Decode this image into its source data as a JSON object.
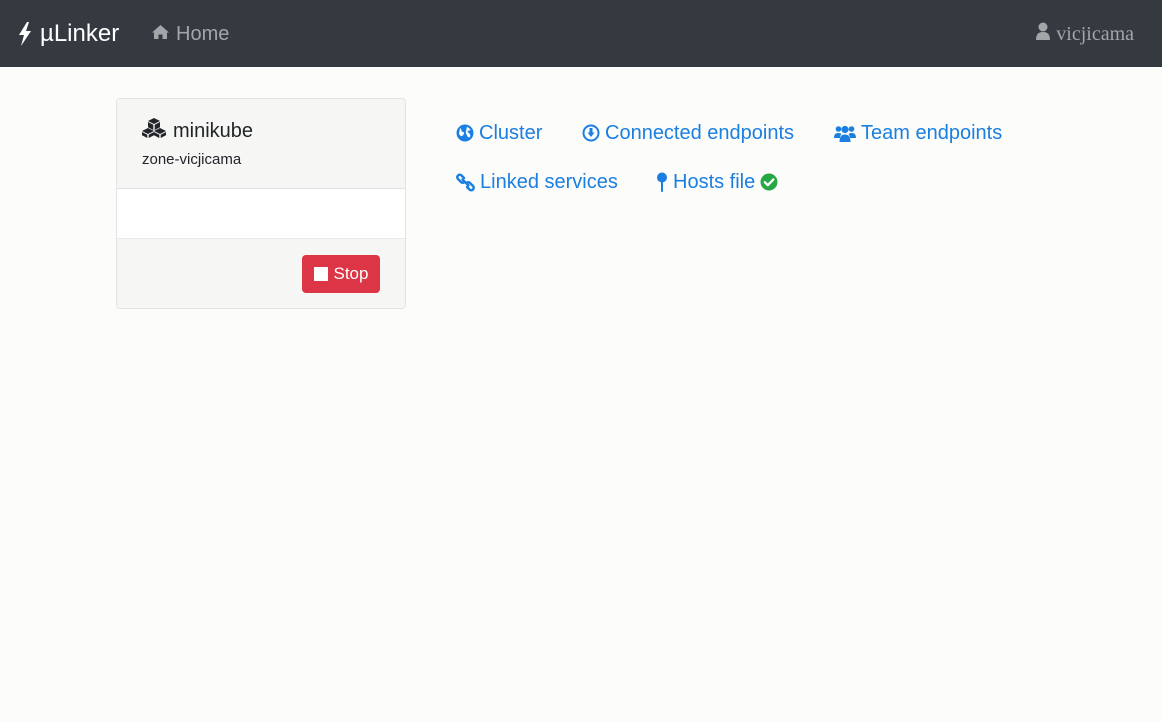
{
  "navbar": {
    "brand_icon": "bolt-icon",
    "brand": "µLinker",
    "home_icon": "home-icon",
    "home": "Home",
    "user_icon": "user-icon",
    "user": "vicjicama"
  },
  "card": {
    "icon": "cubes-icon",
    "title": "minikube",
    "subtitle": "zone-vicjicama",
    "stop_icon": "stop-icon",
    "stop_label": "Stop",
    "stop_color": "#dc3545"
  },
  "links": {
    "color": "#1a7fe0",
    "cluster": "Cluster",
    "cluster_icon": "globe-icon",
    "connected": "Connected endpoints",
    "connected_icon": "download-circle-icon",
    "team": "Team endpoints",
    "team_icon": "users-icon",
    "linked": "Linked services",
    "linked_icon": "link-icon",
    "hosts": "Hosts file",
    "hosts_icon": "map-pin-icon",
    "hosts_status_icon": "check-circle-icon",
    "hosts_status_color": "#28a745"
  }
}
